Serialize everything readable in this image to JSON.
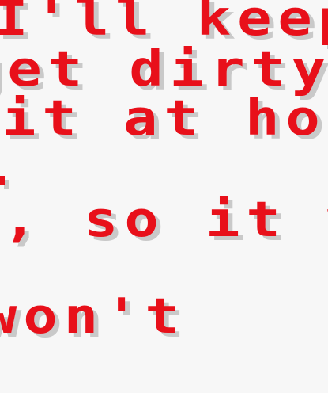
{
  "dialog": {
    "lines": [
      "I'll keep",
      "get dirty.",
      "it at hom",
      "e, so it w",
      "won't"
    ]
  }
}
